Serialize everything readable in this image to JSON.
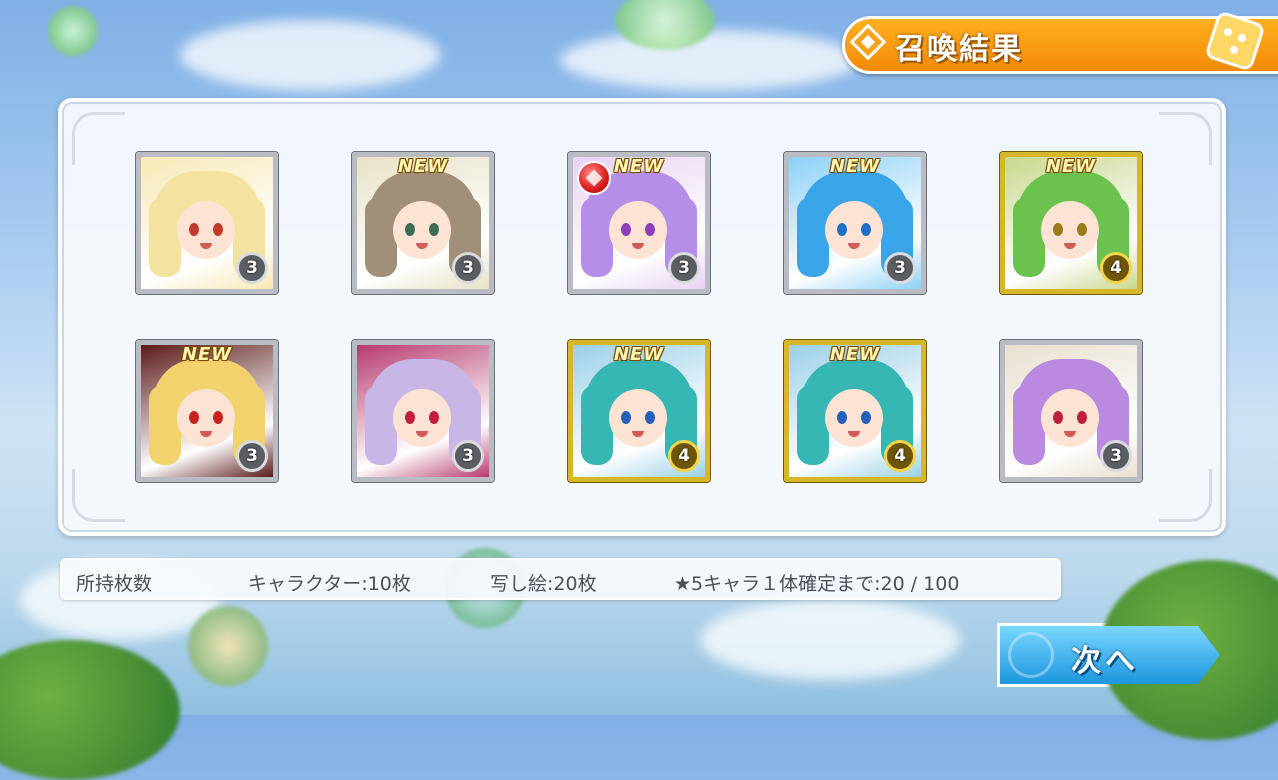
{
  "header": {
    "title": "召喚結果",
    "icon": "diamond-icon",
    "decoration_icon": "dice-icon",
    "color": "#f48a07"
  },
  "results": {
    "cards": [
      {
        "new": false,
        "new_label": "",
        "rarity": "3",
        "frame": "silver",
        "hair": "#f4e3a0",
        "eyes": "#c13a2b",
        "bg": "#f7e9b5"
      },
      {
        "new": true,
        "new_label": "NEW",
        "rarity": "3",
        "frame": "silver",
        "hair": "#a09079",
        "eyes": "#3f6b59",
        "bg": "#e8e2c6"
      },
      {
        "new": true,
        "new_label": "NEW",
        "rarity": "3",
        "frame": "silver",
        "hair": "#b58ee8",
        "eyes": "#8c3fb8",
        "bg": "#e7d3f2",
        "gem": true
      },
      {
        "new": true,
        "new_label": "NEW",
        "rarity": "3",
        "frame": "silver",
        "hair": "#3aa4e8",
        "eyes": "#1f6fc6",
        "bg": "#8ed1f7"
      },
      {
        "new": true,
        "new_label": "NEW",
        "rarity": "4",
        "frame": "gold",
        "hair": "#6cc24f",
        "eyes": "#9a7a1a",
        "bg": "#c8d88e"
      },
      {
        "new": true,
        "new_label": "NEW",
        "rarity": "3",
        "frame": "silver",
        "hair": "#f1d26d",
        "eyes": "#c82121",
        "bg": "#5b1a1a"
      },
      {
        "new": false,
        "new_label": "",
        "rarity": "3",
        "frame": "silver",
        "hair": "#c8b6e6",
        "eyes": "#c21d3a",
        "bg": "#b73a6e"
      },
      {
        "new": true,
        "new_label": "NEW",
        "rarity": "4",
        "frame": "gold",
        "hair": "#36b7b3",
        "eyes": "#2460b8",
        "bg": "#9bd0e8"
      },
      {
        "new": true,
        "new_label": "NEW",
        "rarity": "4",
        "frame": "gold",
        "hair": "#36b7b3",
        "eyes": "#2460b8",
        "bg": "#9bd0e8"
      },
      {
        "new": false,
        "new_label": "",
        "rarity": "3",
        "frame": "silver",
        "hair": "#b98ae0",
        "eyes": "#c11f3b",
        "bg": "#e8e0cf"
      }
    ]
  },
  "info": {
    "label": "所持枚数",
    "characters": "キャラクター:10枚",
    "pictures": "写し絵:20枚",
    "guarantee": "★5キャラ１体確定まで:20 / 100"
  },
  "next_button": {
    "label": "次へ",
    "color": "#1c96dd"
  }
}
